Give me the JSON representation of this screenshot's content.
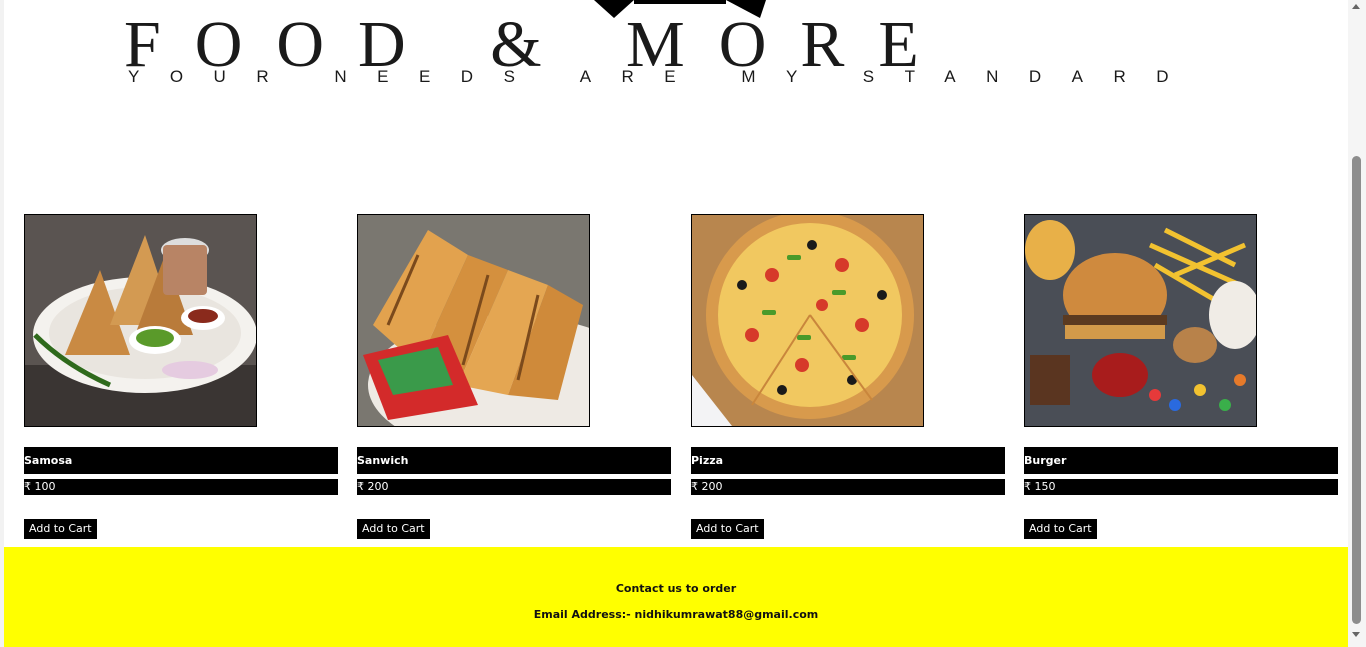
{
  "brand": {
    "title": "FOOD & MORE",
    "tagline": "YOUR NEEDS ARE MY STANDARD"
  },
  "products": [
    {
      "name": "Samosa",
      "price": "₹ 100",
      "button": "Add to Cart"
    },
    {
      "name": "Sanwich",
      "price": "₹ 200",
      "button": "Add to Cart"
    },
    {
      "name": "Pizza",
      "price": "₹ 200",
      "button": "Add to Cart"
    },
    {
      "name": "Burger",
      "price": "₹ 150",
      "button": "Add to Cart"
    }
  ],
  "footer": {
    "title": "Contact us to order",
    "email": "Email Address:- nidhikumrawat88@gmail.com"
  },
  "colors": {
    "footer_bg": "#ffff00",
    "label_bg": "#000000"
  }
}
